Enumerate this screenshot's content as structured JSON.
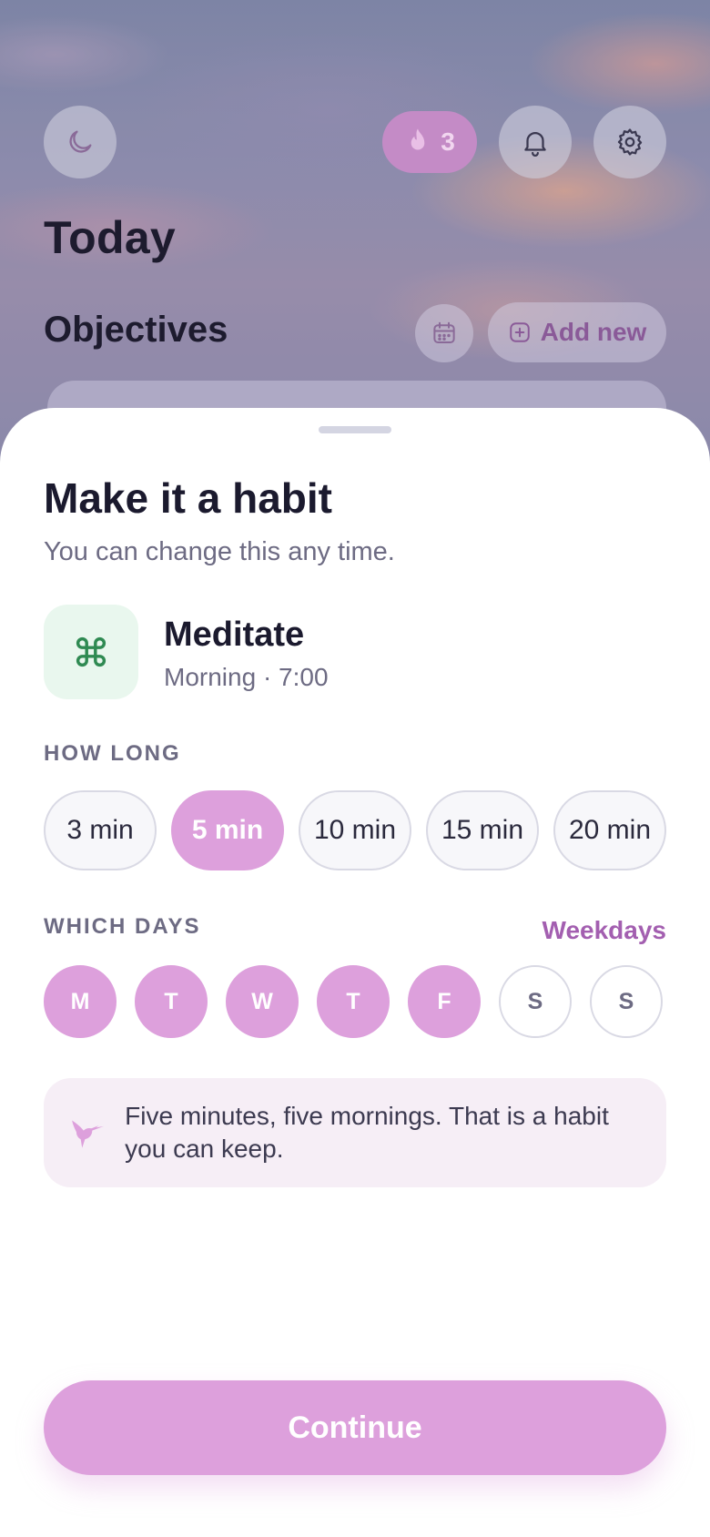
{
  "background": {
    "title": "Today",
    "objectives_label": "Objectives",
    "streak_count": "3",
    "add_new_label": "Add new",
    "icons": [
      "moon-icon",
      "flame-icon",
      "bell-icon",
      "gear-icon",
      "calendar-icon",
      "plus-square-icon"
    ]
  },
  "sheet": {
    "title": "Make it a habit",
    "subtitle": "You can change this any time.",
    "habit": {
      "name": "Meditate",
      "schedule": "Morning · 7:00",
      "icon": "clover-icon"
    },
    "how_long": {
      "label": "HOW LONG",
      "options": [
        "3 min",
        "5 min",
        "10 min",
        "15 min",
        "20 min"
      ],
      "selected": "5 min"
    },
    "which_days": {
      "label": "WHICH DAYS",
      "preset_link": "Weekdays",
      "days": [
        "M",
        "T",
        "W",
        "T",
        "F",
        "S",
        "S"
      ],
      "selected": [
        true,
        true,
        true,
        true,
        true,
        false,
        false
      ]
    },
    "tip": {
      "text": "Five minutes, five mornings. That is a habit you can keep.",
      "icon": "hummingbird-icon"
    },
    "continue_label": "Continue"
  },
  "colors": {
    "accent": "#dda0dc",
    "accent_text": "#a35fb0",
    "habit_icon_bg": "#e9f7ee",
    "habit_icon": "#2f8a52"
  }
}
